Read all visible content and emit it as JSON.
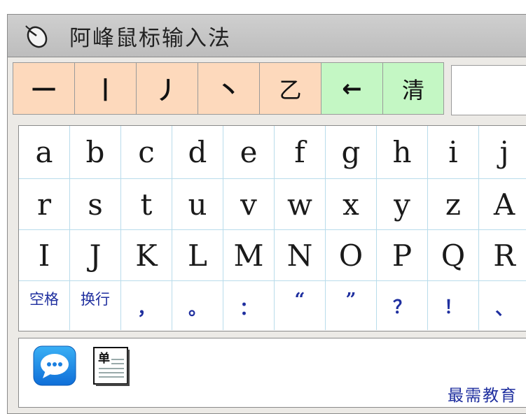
{
  "window": {
    "title": "阿峰鼠标输入法",
    "title_icon": "mouse-icon"
  },
  "stroke_buttons": [
    {
      "label": "一",
      "color": "#fdd9bc"
    },
    {
      "label": "丨",
      "color": "#fdd9bc"
    },
    {
      "label": "丿",
      "color": "#fdd9bc"
    },
    {
      "label": "丶",
      "color": "#fdd9bc"
    },
    {
      "label": "乙",
      "color": "#fdd9bc"
    },
    {
      "label": "←",
      "color": "#c4f7c4"
    },
    {
      "label": "清",
      "color": "#c4f7c4"
    }
  ],
  "input": {
    "value": ""
  },
  "grid": {
    "rows": [
      [
        "a",
        "b",
        "c",
        "d",
        "e",
        "f",
        "g",
        "h",
        "i",
        "j"
      ],
      [
        "r",
        "s",
        "t",
        "u",
        "v",
        "w",
        "x",
        "y",
        "z",
        "A"
      ],
      [
        "I",
        "J",
        "K",
        "L",
        "M",
        "N",
        "O",
        "P",
        "Q",
        "R"
      ],
      [
        "空格",
        "换行",
        "，",
        "。",
        "：",
        "“",
        "”",
        "？",
        "！",
        "、"
      ]
    ]
  },
  "bottom": {
    "chat_icon": "chat-bubble-icon",
    "doc_icon": "document-icon",
    "doc_icon_text": "单",
    "brand": "最需教育"
  },
  "colors": {
    "stroke_bg": "#fdd9bc",
    "action_bg": "#c4f7c4",
    "grid_line": "#b9dceb",
    "punct_text": "#1f2f9f"
  }
}
